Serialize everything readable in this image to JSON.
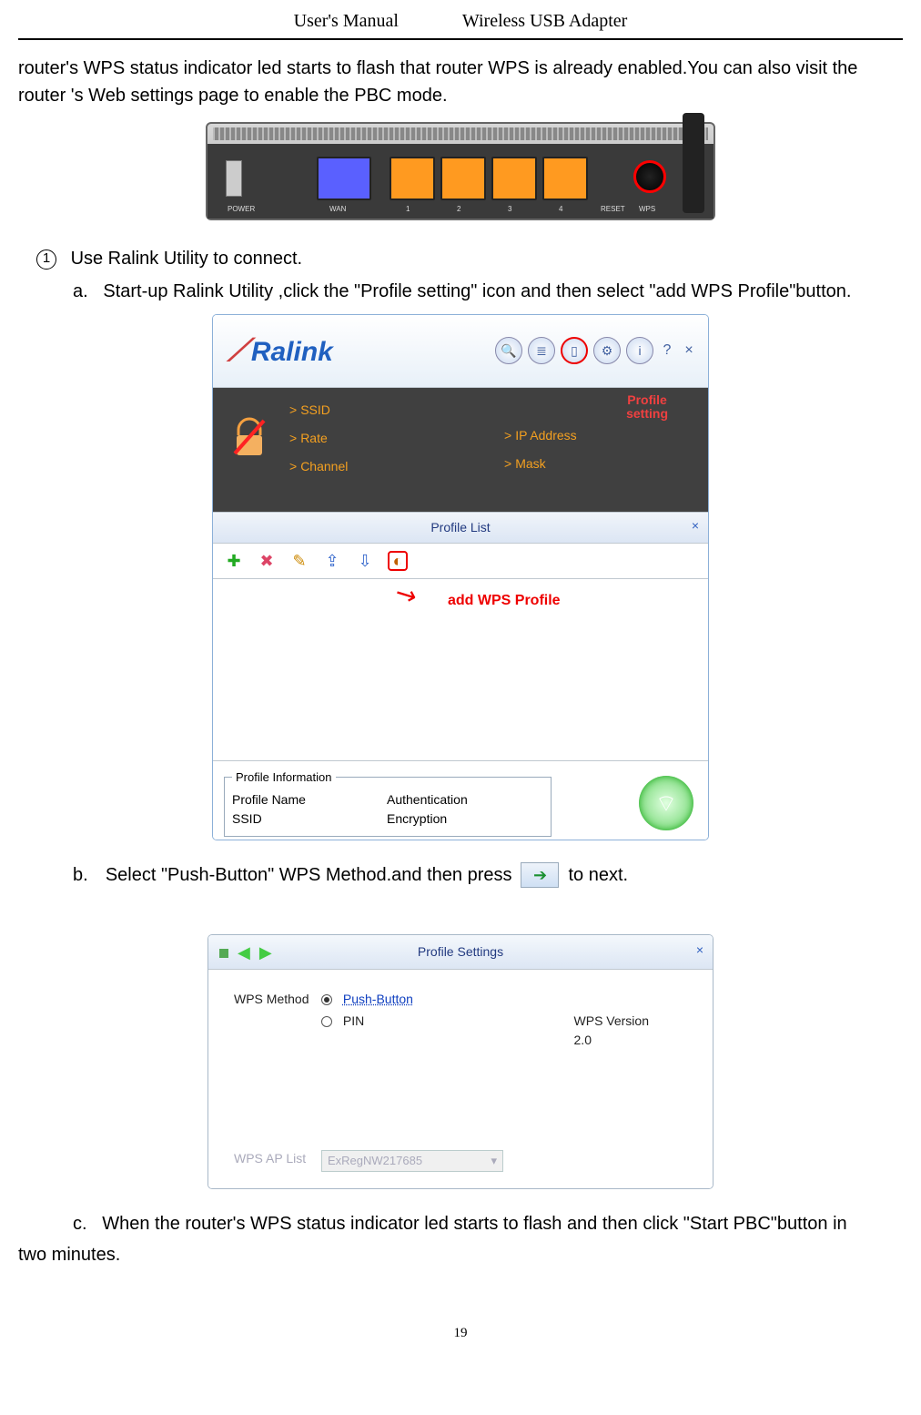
{
  "header": {
    "left": "User's Manual",
    "right": "Wireless USB Adapter"
  },
  "intro": "router's WPS status indicator led starts to flash that router WPS is already enabled.You can also visit the router 's   Web settings page to enable the PBC mode.",
  "router": {
    "labels": {
      "power": "POWER",
      "wan": "WAN",
      "p1": "1",
      "p2": "2",
      "p3": "3",
      "p4": "4",
      "reset": "RESET",
      "wps": "WPS"
    }
  },
  "step1": {
    "num": "1",
    "text": "Use Ralink Utility to connect.",
    "a": "Start-up Ralink Utility ,click the \"Profile setting\" icon and then select \"add WPS Profile\"button.",
    "a_prefix": "a.",
    "b_prefix": "b.",
    "b_part1": "Select \"Push-Button\" WPS Method.and then press",
    "b_part2": "to next.",
    "c_prefix": "c.",
    "c_text": "When the router's WPS status indicator led starts to flash and then click \"Start PBC\"button in"
  },
  "after_c": "two minutes.",
  "ralink1": {
    "logo": "Ralink",
    "annot_profile_setting_l1": "Profile",
    "annot_profile_setting_l2": "setting",
    "info_labels": {
      "ssid": "SSID",
      "rate": "Rate",
      "channel": "Channel",
      "ip": "IP Address",
      "mask": "Mask"
    },
    "profile_list_title": "Profile List",
    "annot_add_wps": "add WPS Profile",
    "footer": {
      "legend": "Profile Information",
      "pname": "Profile Name",
      "ssid": "SSID",
      "auth": "Authentication",
      "enc": "Encryption"
    }
  },
  "ralink2": {
    "title": "Profile Settings",
    "method_label": "WPS Method",
    "opt_push": "Push-Button",
    "opt_pin": "PIN",
    "ver_label": "WPS Version",
    "ver_val": "2.0",
    "aplist_label": "WPS AP List",
    "aplist_val": "ExRegNW217685"
  },
  "page_number": "19"
}
